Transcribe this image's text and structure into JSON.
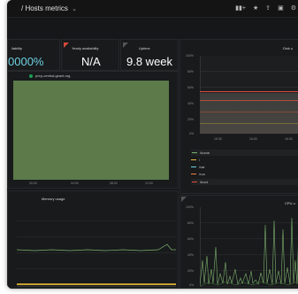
{
  "header": {
    "title": "/ Hosts metrics",
    "caret": "⌄"
  },
  "toolbar": {
    "icons": [
      "chart-add-icon",
      "star-icon",
      "share-icon",
      "save-icon",
      "settings-icon"
    ],
    "glyphs": [
      "▮▮+",
      "★",
      "⇪",
      "▣",
      "⚙"
    ]
  },
  "stats": [
    {
      "label": "ilability",
      "value": "0000%",
      "color": "#6ed0e0"
    },
    {
      "label": "Yearly availability",
      "value": "N/A",
      "color": "#ffffff"
    },
    {
      "label": "Uptime",
      "value": "9.8 week",
      "color": "#ffffff"
    }
  ],
  "host_panel": {
    "legend": "prep-central.geant.org",
    "legend_color": "#1a9e56",
    "fill_color": "#5c7a4a",
    "x_ticks": [
      "00:00",
      "04:00",
      "08:00",
      "12:00"
    ]
  },
  "disk_panel": {
    "title": "Disk u",
    "y_ticks": [
      "100%",
      "80%",
      "60%",
      "40%",
      "20%",
      "0%"
    ],
    "x_ticks": [
      "15:30",
      "16:00",
      "16:30"
    ],
    "series": [
      {
        "name": "/home",
        "color": "#7eb26d"
      },
      {
        "name": "/",
        "color": "#eab839"
      },
      {
        "name": "/var",
        "color": "#6ed0e0"
      },
      {
        "name": "/run",
        "color": "#ef843c"
      },
      {
        "name": "/boot",
        "color": "#e24d42"
      }
    ]
  },
  "memory_panel": {
    "title": "Memory usage"
  },
  "cpu_panel": {
    "title": "CPU u",
    "y_ticks": [
      "100%",
      "80%",
      "60%",
      "40%",
      "20%",
      "0%"
    ]
  }
}
